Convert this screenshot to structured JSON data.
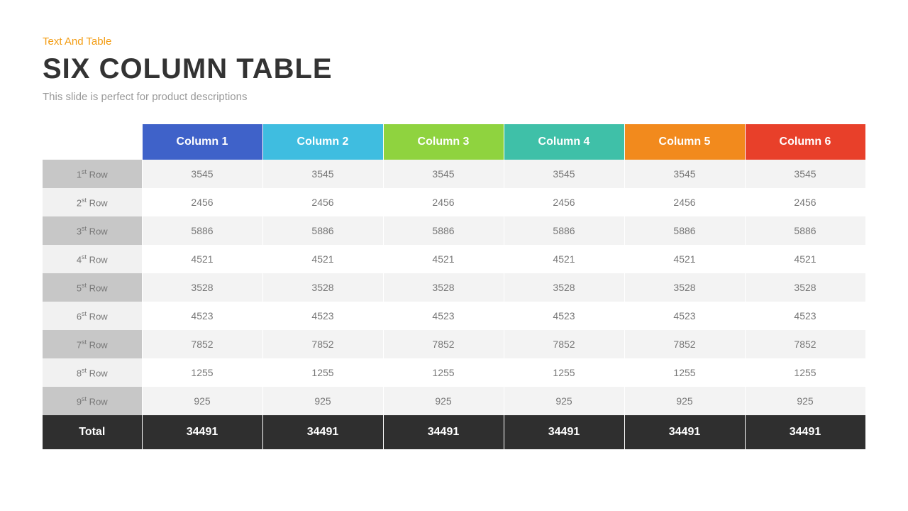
{
  "kicker": "Text And Table",
  "title": "SIX COLUMN TABLE",
  "subtitle": "This slide is perfect for product descriptions",
  "columns": [
    {
      "label": "Column 1",
      "color": "#3f62c9"
    },
    {
      "label": "Column 2",
      "color": "#3fbde0"
    },
    {
      "label": "Column 3",
      "color": "#8fd33f"
    },
    {
      "label": "Column 4",
      "color": "#3fc0a8"
    },
    {
      "label": "Column 5",
      "color": "#f28a1d"
    },
    {
      "label": "Column 6",
      "color": "#e8402a"
    }
  ],
  "rows": [
    {
      "ord": "1",
      "suffix": "st",
      "label_tail": " Row",
      "values": [
        "3545",
        "3545",
        "3545",
        "3545",
        "3545",
        "3545"
      ]
    },
    {
      "ord": "2",
      "suffix": "st",
      "label_tail": " Row",
      "values": [
        "2456",
        "2456",
        "2456",
        "2456",
        "2456",
        "2456"
      ]
    },
    {
      "ord": "3",
      "suffix": "st",
      "label_tail": " Row",
      "values": [
        "5886",
        "5886",
        "5886",
        "5886",
        "5886",
        "5886"
      ]
    },
    {
      "ord": "4",
      "suffix": "st",
      "label_tail": " Row",
      "values": [
        "4521",
        "4521",
        "4521",
        "4521",
        "4521",
        "4521"
      ]
    },
    {
      "ord": "5",
      "suffix": "st",
      "label_tail": " Row",
      "values": [
        "3528",
        "3528",
        "3528",
        "3528",
        "3528",
        "3528"
      ]
    },
    {
      "ord": "6",
      "suffix": "st",
      "label_tail": " Row",
      "values": [
        "4523",
        "4523",
        "4523",
        "4523",
        "4523",
        "4523"
      ]
    },
    {
      "ord": "7",
      "suffix": "st",
      "label_tail": " Row",
      "values": [
        "7852",
        "7852",
        "7852",
        "7852",
        "7852",
        "7852"
      ]
    },
    {
      "ord": "8",
      "suffix": "st",
      "label_tail": " Row",
      "values": [
        "1255",
        "1255",
        "1255",
        "1255",
        "1255",
        "1255"
      ]
    },
    {
      "ord": "9",
      "suffix": "st",
      "label_tail": " Row",
      "values": [
        "925",
        "925",
        "925",
        "925",
        "925",
        "925"
      ]
    }
  ],
  "total": {
    "label": "Total",
    "values": [
      "34491",
      "34491",
      "34491",
      "34491",
      "34491",
      "34491"
    ]
  },
  "chart_data": {
    "type": "table",
    "title": "SIX COLUMN TABLE",
    "columns": [
      "Column 1",
      "Column 2",
      "Column 3",
      "Column 4",
      "Column 5",
      "Column 6"
    ],
    "row_labels": [
      "1st Row",
      "2st Row",
      "3st Row",
      "4st Row",
      "5st Row",
      "6st Row",
      "7st Row",
      "8st Row",
      "9st Row"
    ],
    "data": [
      [
        3545,
        3545,
        3545,
        3545,
        3545,
        3545
      ],
      [
        2456,
        2456,
        2456,
        2456,
        2456,
        2456
      ],
      [
        5886,
        5886,
        5886,
        5886,
        5886,
        5886
      ],
      [
        4521,
        4521,
        4521,
        4521,
        4521,
        4521
      ],
      [
        3528,
        3528,
        3528,
        3528,
        3528,
        3528
      ],
      [
        4523,
        4523,
        4523,
        4523,
        4523,
        4523
      ],
      [
        7852,
        7852,
        7852,
        7852,
        7852,
        7852
      ],
      [
        1255,
        1255,
        1255,
        1255,
        1255,
        1255
      ],
      [
        925,
        925,
        925,
        925,
        925,
        925
      ]
    ],
    "totals": [
      34491,
      34491,
      34491,
      34491,
      34491,
      34491
    ]
  }
}
